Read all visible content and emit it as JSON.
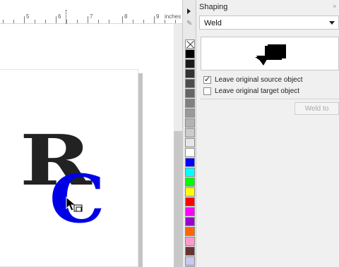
{
  "ruler": {
    "numbers": [
      "5",
      "6",
      "7",
      "8",
      "9"
    ],
    "unit": "inches"
  },
  "canvas": {
    "letter_r": "R",
    "letter_c": "C"
  },
  "palette": {
    "colors": [
      "#000000",
      "#1a1a1a",
      "#333333",
      "#4d4d4d",
      "#666666",
      "#808080",
      "#999999",
      "#b3b3b3",
      "#cccccc",
      "#e6e6e6",
      "#ffffff",
      "#0000ff",
      "#00ffff",
      "#00ff00",
      "#ffff00",
      "#ff0000",
      "#ff00ff",
      "#9900cc",
      "#ff6600",
      "#ff99cc",
      "#663333",
      "#c8c8f0",
      "#8888ff"
    ]
  },
  "docker": {
    "title": "Shaping",
    "operation_value": "Weld",
    "leave_source_label": "Leave original source object",
    "leave_source_checked": true,
    "leave_target_label": "Leave original target object",
    "leave_target_checked": false,
    "apply_button_label": "Weld to"
  }
}
